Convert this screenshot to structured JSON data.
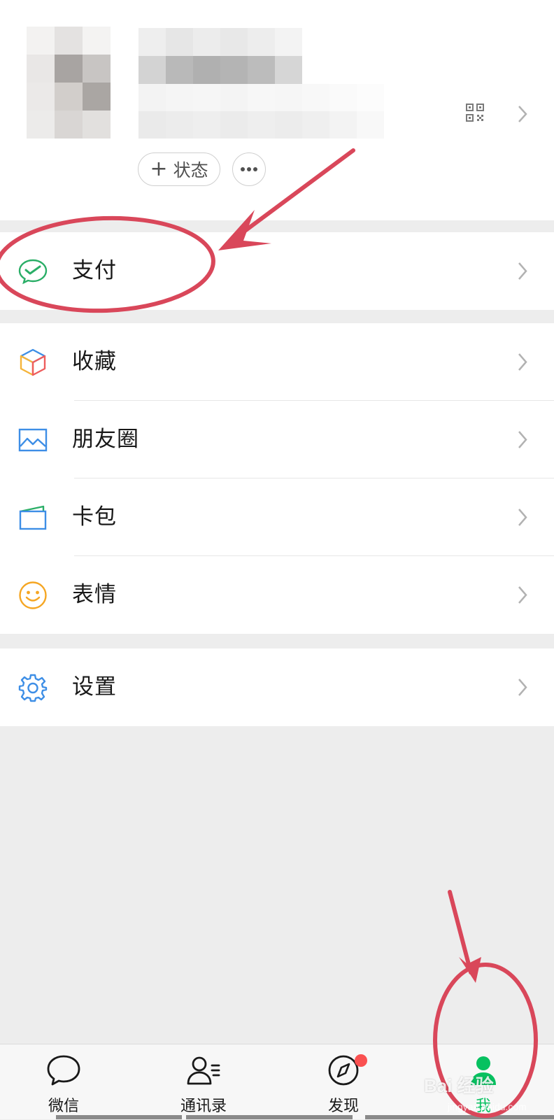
{
  "profile": {
    "status_label": "状态",
    "status_plus": "+",
    "qr_icon": "qr-code-icon",
    "more_icon": "ellipsis-icon"
  },
  "menu": {
    "pay": {
      "label": "支付",
      "icon": "wechat-pay-icon"
    },
    "favorites": {
      "label": "收藏",
      "icon": "cube-icon"
    },
    "moments": {
      "label": "朋友圈",
      "icon": "picture-icon"
    },
    "card_package": {
      "label": "卡包",
      "icon": "card-icon"
    },
    "stickers": {
      "label": "表情",
      "icon": "smiley-icon"
    },
    "settings": {
      "label": "设置",
      "icon": "gear-icon"
    }
  },
  "tabs": [
    {
      "label": "微信",
      "icon": "chat-bubble-icon",
      "active": false
    },
    {
      "label": "通讯录",
      "icon": "contacts-icon",
      "active": false
    },
    {
      "label": "发现",
      "icon": "compass-icon",
      "active": false,
      "badge": "red-dot"
    },
    {
      "label": "我",
      "icon": "person-icon",
      "active": true
    }
  ],
  "watermark": {
    "text": "Bai 经验",
    "sub": "jingyan.baidu.com"
  },
  "colors": {
    "accent_green": "#07c160",
    "annotation_red": "#d9475a",
    "badge_red": "#fa5151",
    "background": "#ededed"
  }
}
